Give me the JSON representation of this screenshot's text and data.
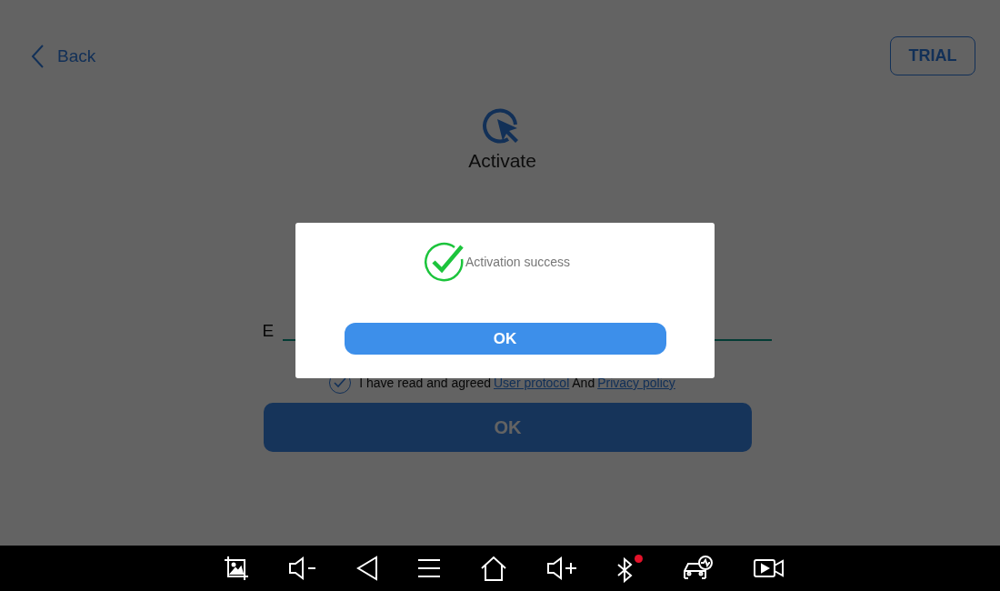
{
  "header": {
    "back_label": "Back",
    "trial_label": "TRIAL"
  },
  "title": "Activate",
  "field": {
    "label": "E"
  },
  "agreement": {
    "checked": true,
    "text": "I have read and agreed",
    "link1": "User protocol",
    "joiner": "And",
    "link2": "Privacy policy"
  },
  "submit_label": "OK",
  "dialog": {
    "message": "Activation success",
    "button": "OK"
  },
  "nav_bar": {
    "bluetooth_alert": true
  }
}
